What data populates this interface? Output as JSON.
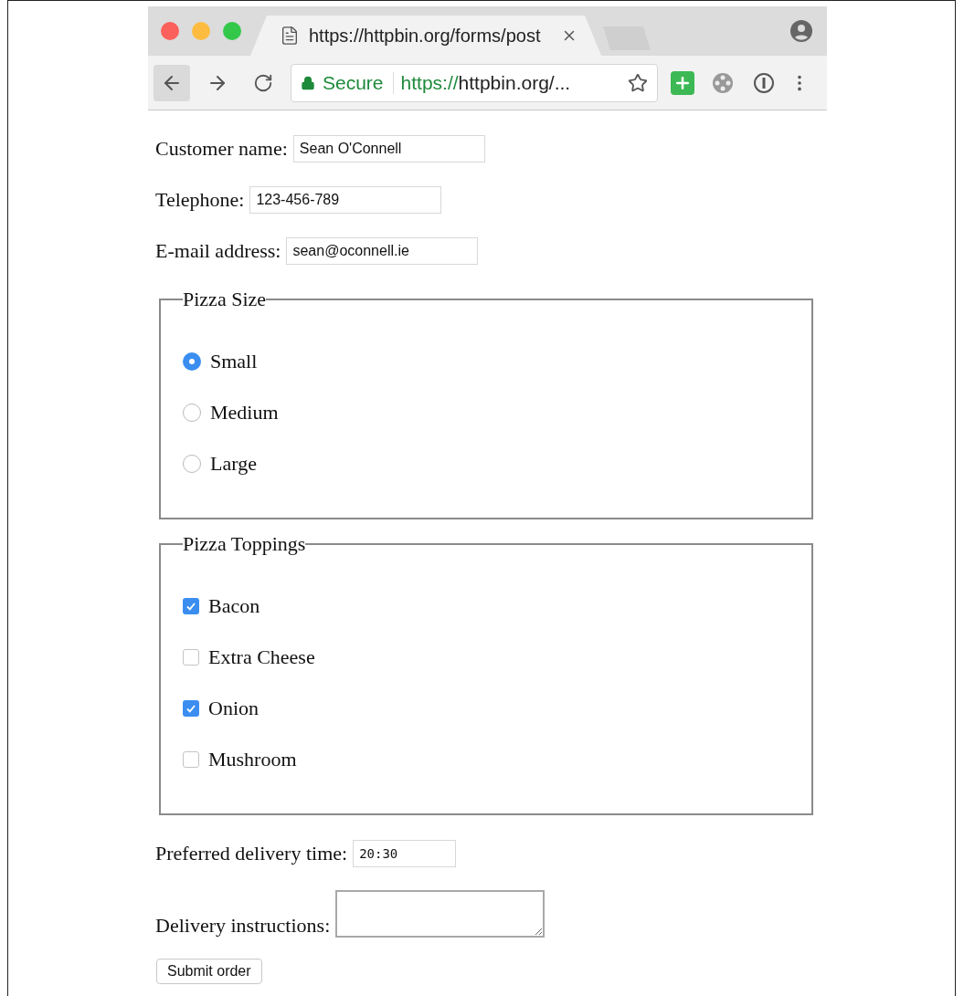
{
  "browser": {
    "tab_title": "https://httpbin.org/forms/post",
    "security": "Secure",
    "url_scheme": "https://",
    "url_rest": "httpbin.org/..."
  },
  "fields": [
    {
      "label": "Customer name:",
      "value": "Sean O'Connell"
    },
    {
      "label": "Telephone:",
      "value": "123-456-789"
    },
    {
      "label": "E-mail address:",
      "value": "sean@oconnell.ie"
    }
  ],
  "fieldsets": [
    {
      "legend": "Pizza Size",
      "kind": "radio",
      "options": [
        {
          "label": "Small",
          "selected": true
        },
        {
          "label": "Medium",
          "selected": false
        },
        {
          "label": "Large",
          "selected": false
        }
      ]
    },
    {
      "legend": "Pizza Toppings",
      "kind": "checkbox",
      "options": [
        {
          "label": "Bacon",
          "checked": true
        },
        {
          "label": "Extra Cheese",
          "checked": false
        },
        {
          "label": "Onion",
          "checked": true
        },
        {
          "label": "Mushroom",
          "checked": false
        }
      ]
    }
  ],
  "delivery_time": {
    "label": "Preferred delivery time:",
    "value": "20:30"
  },
  "instructions": {
    "label": "Delivery instructions:"
  },
  "submit": "Submit order"
}
